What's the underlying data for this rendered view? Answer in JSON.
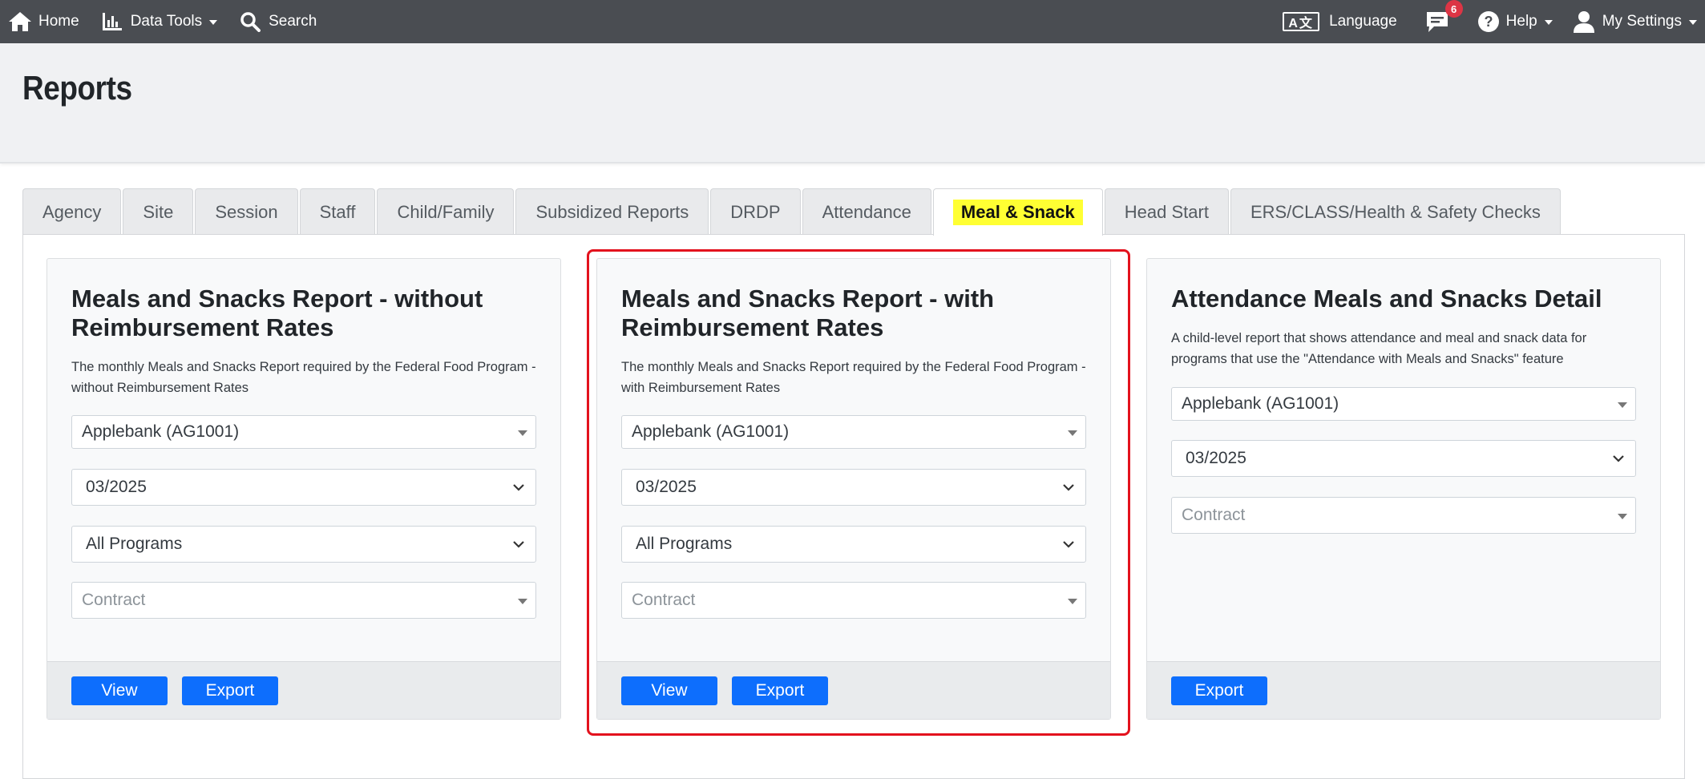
{
  "nav": {
    "home": "Home",
    "data_tools": "Data Tools",
    "search": "Search",
    "language": "Language",
    "language_icon_text": "A文",
    "notifications_count": "6",
    "help": "Help",
    "settings": "My Settings"
  },
  "page_title": "Reports",
  "tabs": [
    "Agency",
    "Site",
    "Session",
    "Staff",
    "Child/Family",
    "Subsidized Reports",
    "DRDP",
    "Attendance",
    "Meal & Snack",
    "Head Start",
    "ERS/CLASS/Health & Safety Checks"
  ],
  "active_tab": "Meal & Snack",
  "cards": [
    {
      "title": "Meals and Snacks Report - without Reimbursement Rates",
      "description": "The monthly Meals and Snacks Report required by the Federal Food Program - without Reimbursement Rates",
      "agency": "Applebank (AG1001)",
      "month": "03/2025",
      "program": "All Programs",
      "contract_placeholder": "Contract",
      "view_label": "View",
      "export_label": "Export"
    },
    {
      "title": "Meals and Snacks Report - with Reimbursement Rates",
      "description": "The monthly Meals and Snacks Report required by the Federal Food Program - with Reimbursement Rates",
      "agency": "Applebank (AG1001)",
      "month": "03/2025",
      "program": "All Programs",
      "contract_placeholder": "Contract",
      "view_label": "View",
      "export_label": "Export"
    },
    {
      "title": "Attendance Meals and Snacks Detail",
      "description": "A child-level report that shows attendance and meal and snack data for programs that use the \"Attendance with Meals and Snacks\" feature",
      "agency": "Applebank (AG1001)",
      "month": "03/2025",
      "contract_placeholder": "Contract",
      "export_label": "Export"
    }
  ],
  "colors": {
    "nav_bg": "#4a4d52",
    "primary_button": "#0d6efd",
    "tab_highlight": "#ffff33",
    "selection_outline": "#e3121d",
    "badge": "#dc3545"
  }
}
